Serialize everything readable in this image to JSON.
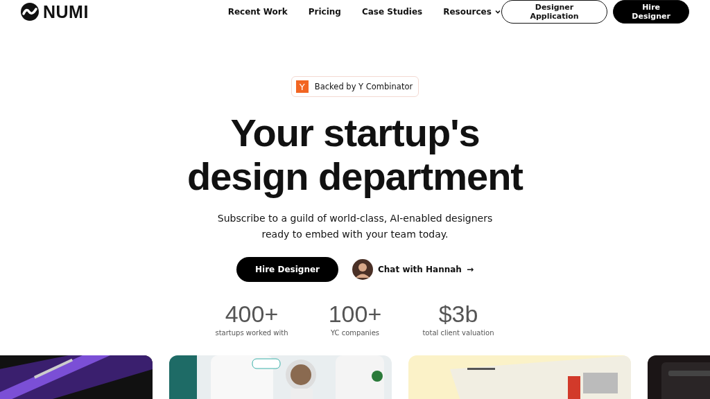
{
  "nav": {
    "brand": "NUMI",
    "links": [
      {
        "label": "Recent Work",
        "dropdown": false
      },
      {
        "label": "Pricing",
        "dropdown": false
      },
      {
        "label": "Case Studies",
        "dropdown": false
      },
      {
        "label": "Resources",
        "dropdown": true
      }
    ],
    "buttons": [
      {
        "label": "Designer Application",
        "kind": "outline"
      },
      {
        "label": "Hire Designer",
        "kind": "solid"
      }
    ]
  },
  "badge": {
    "logo": "Y",
    "label": "Backed by Y Combinator"
  },
  "hero": {
    "title_lines": [
      "Your startup's",
      "design department"
    ],
    "subtitle_lines": [
      "Subscribe to a guild of world-class, AI-enabled designers",
      "ready to embed with your team today."
    ]
  },
  "cta": {
    "primary": "Hire Designer",
    "chat": "Chat with Hannah",
    "chat_arrow": "→"
  },
  "stats": [
    {
      "value": "400+",
      "label": "startups worked with"
    },
    {
      "value": "100+",
      "label": "YC companies"
    },
    {
      "value": "$3b",
      "label": "total client valuation"
    }
  ]
}
